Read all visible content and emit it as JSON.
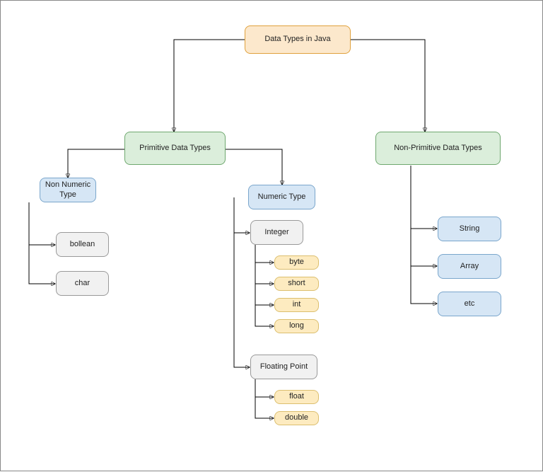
{
  "title": "Data Types in Java",
  "primitive": {
    "label": "Primitive Data Types",
    "nonNumeric": {
      "label": "Non Numeric Type",
      "items": [
        "bollean",
        "char"
      ]
    },
    "numeric": {
      "label": "Numeric Type",
      "integer": {
        "label": "Integer",
        "items": [
          "byte",
          "short",
          "int",
          "long"
        ]
      },
      "floating": {
        "label": "Floating Point",
        "items": [
          "float",
          "double"
        ]
      }
    }
  },
  "nonPrimitive": {
    "label": "Non-Primitive Data Types",
    "items": [
      "String",
      "Array",
      "etc"
    ]
  }
}
